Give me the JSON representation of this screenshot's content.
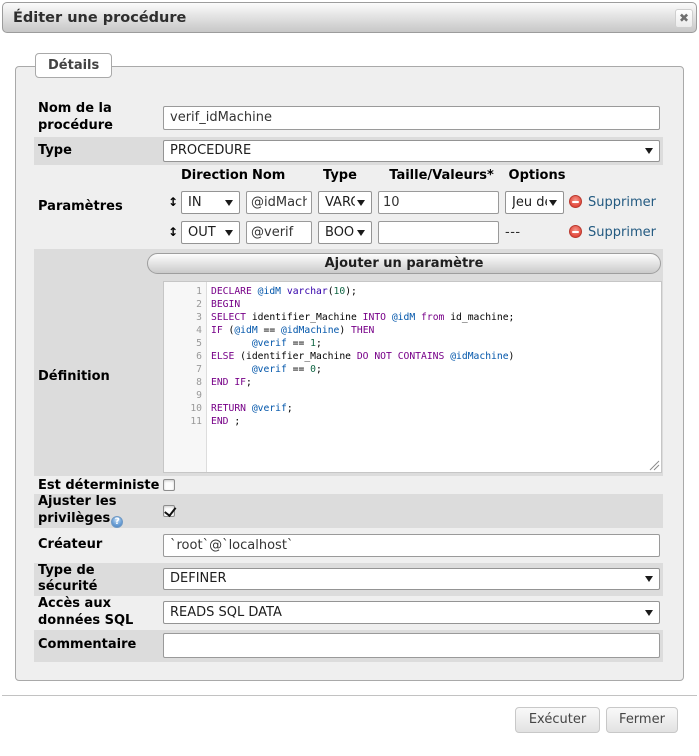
{
  "dialog": {
    "title": "Éditer une procédure",
    "close_icon": "✖"
  },
  "tab": {
    "label": "Détails"
  },
  "form": {
    "name": {
      "label": "Nom de la procédure",
      "value": "verif_idMachine"
    },
    "type": {
      "label": "Type",
      "value": "PROCEDURE"
    },
    "parameters": {
      "label": "Paramètres",
      "headers": {
        "direction": "Direction",
        "name": "Nom",
        "type": "Type",
        "length": "Taille/Valeurs*",
        "options": "Options"
      },
      "drag_icon": "↕",
      "rows": [
        {
          "direction": "IN",
          "name": "@idMachine",
          "type": "VARCHAR",
          "length": "10",
          "options": "Jeu de caractères",
          "remove": "Supprimer"
        },
        {
          "direction": "OUT",
          "name": "@verif",
          "type": "BOOLEAN",
          "length": "",
          "options": "---",
          "remove": "Supprimer"
        }
      ],
      "add_button": "Ajouter un paramètre"
    },
    "definition": {
      "label": "Définition",
      "lines": [
        [
          [
            "k",
            "DECLARE"
          ],
          [
            "p",
            " "
          ],
          [
            "v",
            "@idM"
          ],
          [
            "p",
            " "
          ],
          [
            "b",
            "varchar"
          ],
          [
            "p",
            "("
          ],
          [
            "n",
            "10"
          ],
          [
            "p",
            ");"
          ]
        ],
        [
          [
            "k",
            "BEGIN"
          ]
        ],
        [
          [
            "k",
            "SELECT"
          ],
          [
            "p",
            " identifier_Machine "
          ],
          [
            "k",
            "INTO"
          ],
          [
            "p",
            " "
          ],
          [
            "v",
            "@idM"
          ],
          [
            "p",
            " "
          ],
          [
            "k",
            "from"
          ],
          [
            "p",
            " id_machine;"
          ]
        ],
        [
          [
            "k",
            "IF"
          ],
          [
            "p",
            " ("
          ],
          [
            "v",
            "@idM"
          ],
          [
            "p",
            " == "
          ],
          [
            "v",
            "@idMachine"
          ],
          [
            "p",
            ") "
          ],
          [
            "k",
            "THEN"
          ]
        ],
        [
          [
            "p",
            "       "
          ],
          [
            "v",
            "@verif"
          ],
          [
            "p",
            " == "
          ],
          [
            "n",
            "1"
          ],
          [
            "p",
            ";"
          ]
        ],
        [
          [
            "k",
            "ELSE"
          ],
          [
            "p",
            " (identifier_Machine "
          ],
          [
            "k",
            "DO"
          ],
          [
            "p",
            " "
          ],
          [
            "k",
            "NOT"
          ],
          [
            "p",
            " "
          ],
          [
            "k",
            "CONTAINS"
          ],
          [
            "p",
            " "
          ],
          [
            "v",
            "@idMachine"
          ],
          [
            "p",
            ")"
          ]
        ],
        [
          [
            "p",
            "       "
          ],
          [
            "v",
            "@verif"
          ],
          [
            "p",
            " == "
          ],
          [
            "n",
            "0"
          ],
          [
            "p",
            ";"
          ]
        ],
        [
          [
            "k",
            "END"
          ],
          [
            "p",
            " "
          ],
          [
            "k",
            "IF"
          ],
          [
            "p",
            ";"
          ]
        ],
        [],
        [
          [
            "k",
            "RETURN"
          ],
          [
            "p",
            " "
          ],
          [
            "v",
            "@verif"
          ],
          [
            "p",
            ";"
          ]
        ],
        [
          [
            "k",
            "END"
          ],
          [
            "p",
            " ;"
          ]
        ]
      ]
    },
    "deterministic": {
      "label": "Est déterministe",
      "checked": false
    },
    "privileges": {
      "label": "Ajuster les privilèges",
      "help_icon": "?",
      "checked": true
    },
    "creator": {
      "label": "Créateur",
      "value": "`root`@`localhost`"
    },
    "security": {
      "label": "Type de sécurité",
      "value": "DEFINER"
    },
    "sql_access": {
      "label": "Accès aux données SQL",
      "value": "READS SQL DATA"
    },
    "comment": {
      "label": "Commentaire",
      "value": ""
    }
  },
  "buttons": {
    "execute": "Exécuter",
    "close": "Fermer"
  }
}
